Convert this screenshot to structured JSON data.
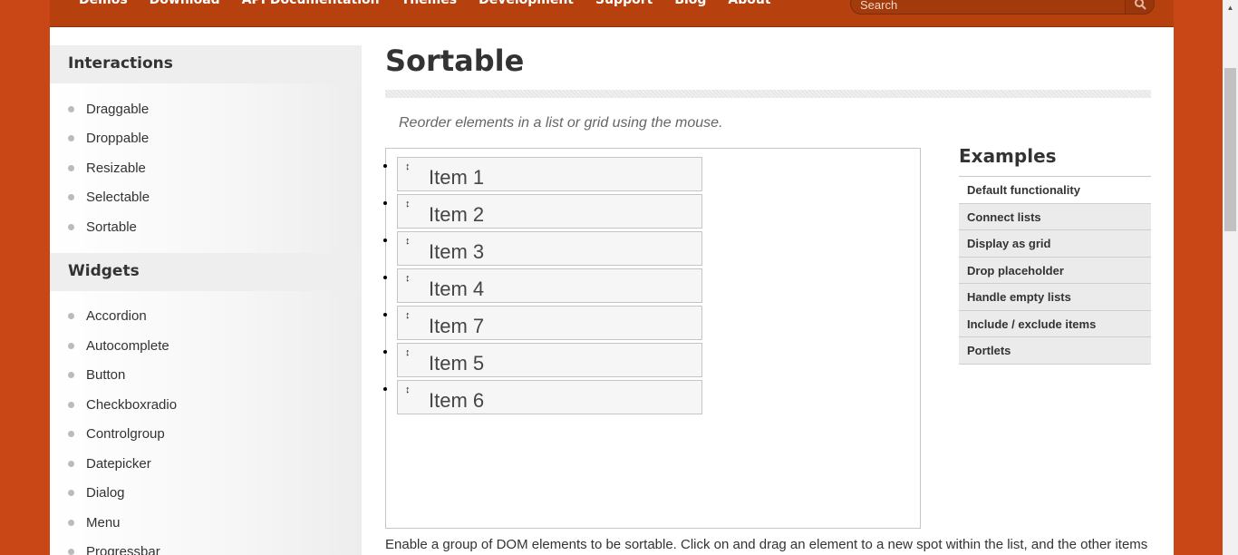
{
  "nav": {
    "items": [
      "Demos",
      "Download",
      "API Documentation",
      "Themes",
      "Development",
      "Support",
      "Blog",
      "About"
    ],
    "search_placeholder": "Search"
  },
  "sidebar": {
    "interactions_title": "Interactions",
    "interactions": [
      "Draggable",
      "Droppable",
      "Resizable",
      "Selectable",
      "Sortable"
    ],
    "widgets_title": "Widgets",
    "widgets": [
      "Accordion",
      "Autocomplete",
      "Button",
      "Checkboxradio",
      "Controlgroup",
      "Datepicker",
      "Dialog",
      "Menu",
      "Progressbar"
    ]
  },
  "main": {
    "title": "Sortable",
    "subtitle": "Reorder elements in a list or grid using the mouse.",
    "sortable_items": [
      "Item 1",
      "Item 2",
      "Item 3",
      "Item 4",
      "Item 7",
      "Item 5",
      "Item 6"
    ],
    "description": "Enable a group of DOM elements to be sortable. Click on and drag an element to a new spot within the list, and the other items"
  },
  "examples": {
    "title": "Examples",
    "items": [
      "Default functionality",
      "Connect lists",
      "Display as grid",
      "Drop placeholder",
      "Handle empty lists",
      "Include / exclude items",
      "Portlets"
    ],
    "active_index": 0
  },
  "colors": {
    "brand": "#c94617",
    "nav_bg": "#b6410f"
  }
}
